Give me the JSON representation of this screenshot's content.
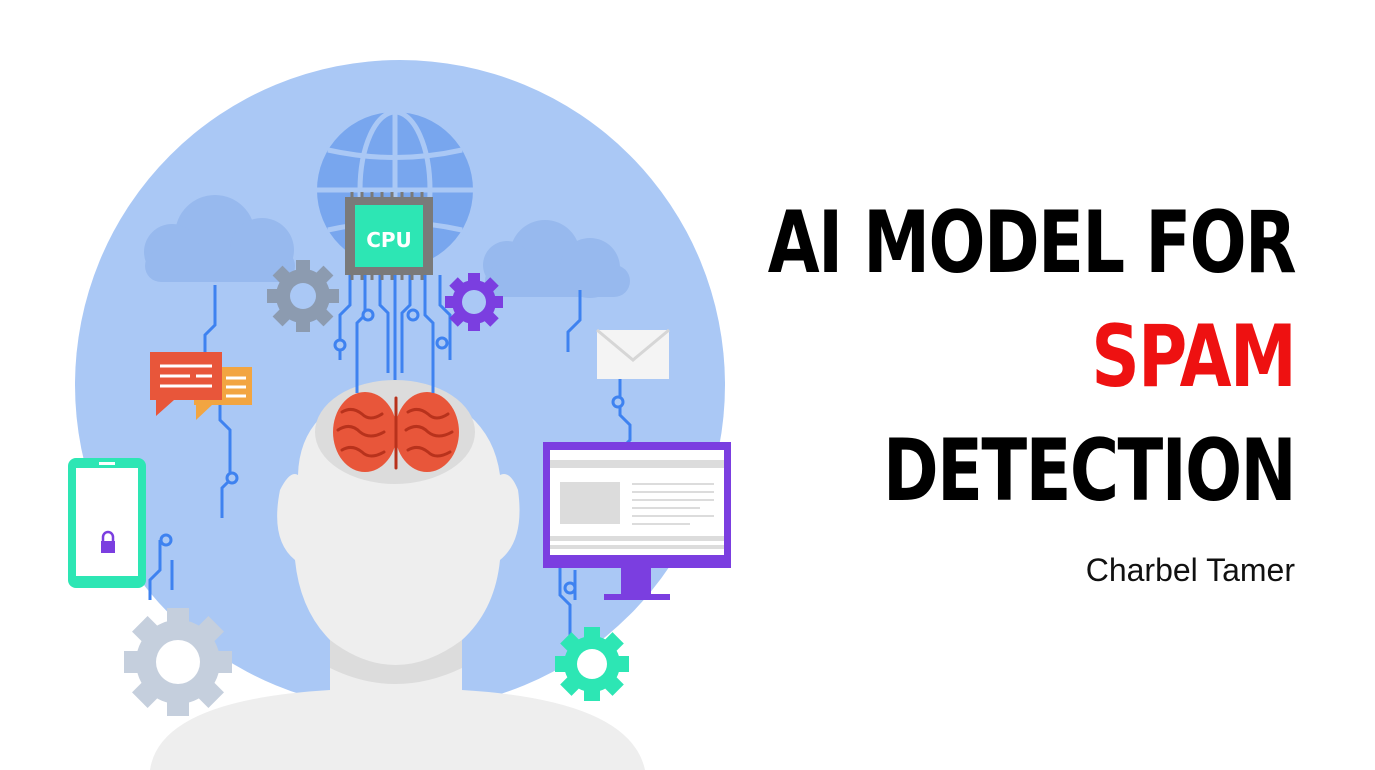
{
  "slide": {
    "title_lines": [
      "AI MODEL FOR",
      "SPAM",
      "DETECTION"
    ],
    "author": "Charbel Tamer"
  },
  "illustration": {
    "cpu_label": "CPU",
    "icons": [
      "globe-icon",
      "cpu-chip-icon",
      "brain-icon",
      "gear-icon",
      "chat-bubble-icon",
      "envelope-icon",
      "smartphone-lock-icon",
      "monitor-icon",
      "cloud-icon"
    ]
  },
  "colors": {
    "accent": "#ee1111",
    "circle": "#aac8f5",
    "brain": "#e8563a",
    "teal": "#2de6b4",
    "purple": "#7b3ee0",
    "circuit": "#3e82f0",
    "globe": "#78a6ee"
  }
}
